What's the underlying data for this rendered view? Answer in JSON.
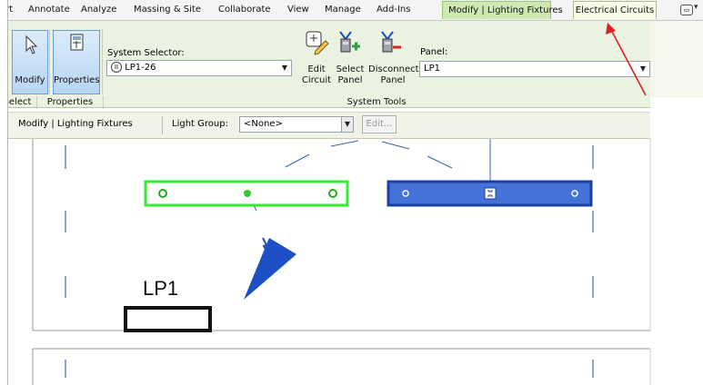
{
  "menu": {
    "tabs": [
      "ert",
      "Annotate",
      "Analyze",
      "Massing & Site",
      "Collaborate",
      "View",
      "Manage",
      "Add-Ins"
    ],
    "context_tabs": [
      "Modify | Lighting Fixtures",
      "Electrical Circuits"
    ]
  },
  "ribbon": {
    "modify_label": "Modify",
    "properties_label": "Properties",
    "select_footer": "Select",
    "properties_footer": "Properties",
    "system_selector_label": "System Selector:",
    "system_selector_value": "LP1-26",
    "edit_circuit_label": [
      "Edit",
      "Circuit"
    ],
    "select_panel_label": [
      "Select",
      "Panel"
    ],
    "disconnect_panel_label": [
      "Disconnect",
      "Panel"
    ],
    "panel_label": "Panel:",
    "panel_value": "LP1",
    "system_tools_footer": "System Tools"
  },
  "options_bar": {
    "context_label": "Modify | Lighting Fixtures",
    "light_group_label": "Light Group:",
    "light_group_value": "<None>",
    "edit_button": "Edit..."
  },
  "canvas": {
    "panel_tag": "LP1"
  },
  "colors": {
    "selected_fixture": "#33ee33",
    "highlighted_fixture": "#3d6fd6",
    "annotation_arrow": "#e02020",
    "ribbon_bg": "#eaf2e1"
  }
}
